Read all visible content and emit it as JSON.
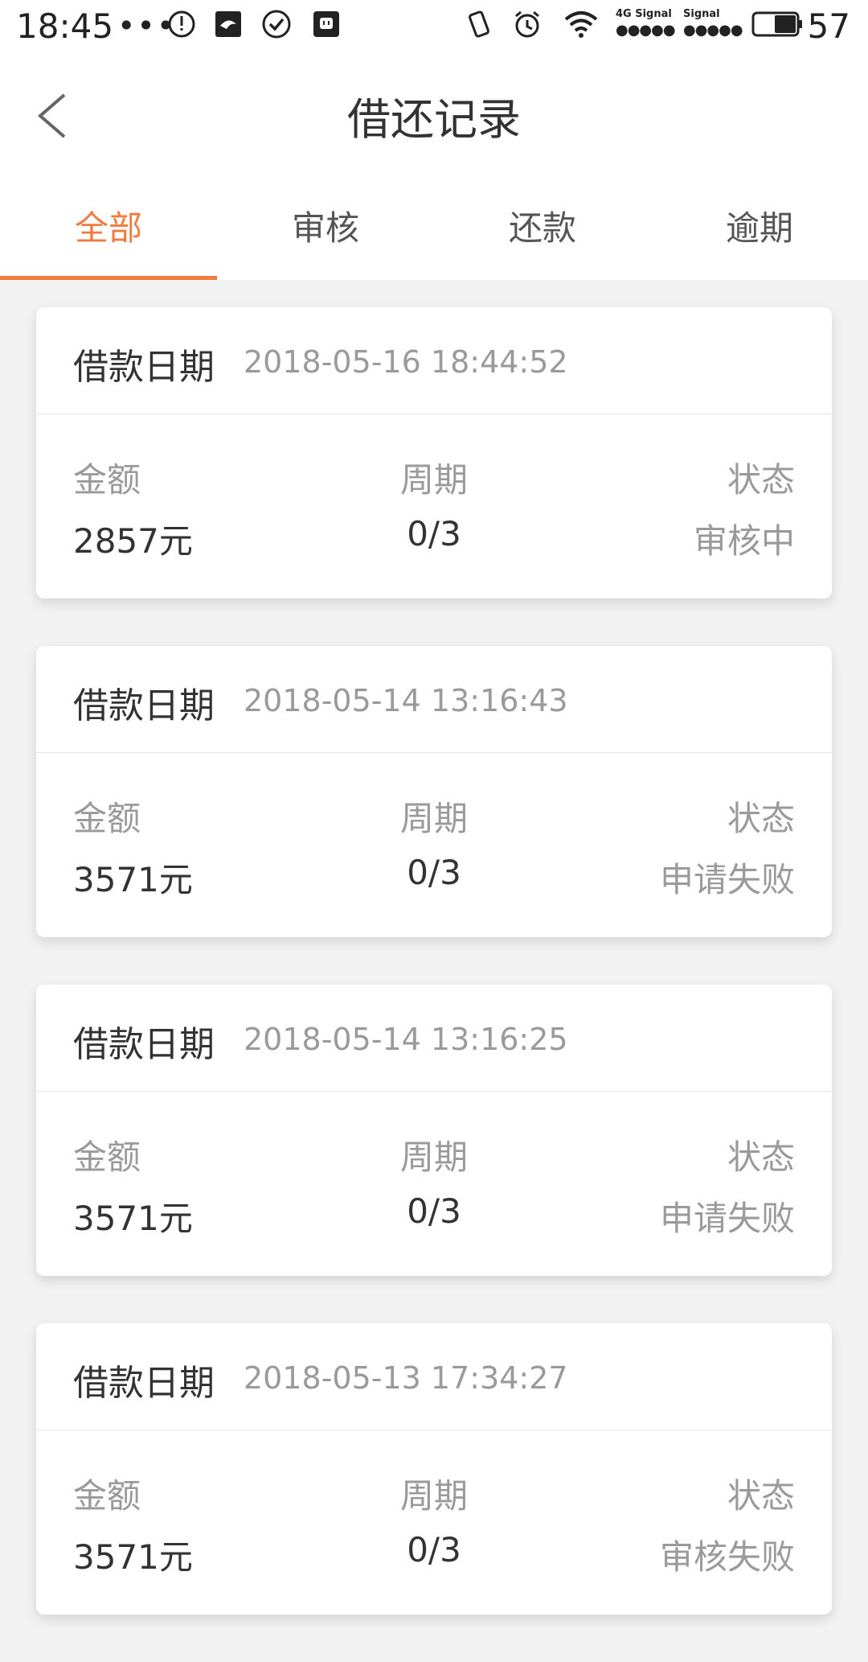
{
  "status_bar": {
    "time": "18:45",
    "dots": "•••",
    "signal_text_1": "4G Signal",
    "signal_text_2": "Signal",
    "battery": "57"
  },
  "header": {
    "title": "借还记录"
  },
  "tabs": [
    {
      "label": "全部",
      "active": true
    },
    {
      "label": "审核",
      "active": false
    },
    {
      "label": "还款",
      "active": false
    },
    {
      "label": "逾期",
      "active": false
    }
  ],
  "records": [
    {
      "date_label": "借款日期",
      "date": "2018-05-16 18:44:52",
      "amount_label": "金额",
      "amount": "2857元",
      "period_label": "周期",
      "period": "0/3",
      "status_label": "状态",
      "status": "审核中"
    },
    {
      "date_label": "借款日期",
      "date": "2018-05-14 13:16:43",
      "amount_label": "金额",
      "amount": "3571元",
      "period_label": "周期",
      "period": "0/3",
      "status_label": "状态",
      "status": "申请失败"
    },
    {
      "date_label": "借款日期",
      "date": "2018-05-14 13:16:25",
      "amount_label": "金额",
      "amount": "3571元",
      "period_label": "周期",
      "period": "0/3",
      "status_label": "状态",
      "status": "申请失败"
    },
    {
      "date_label": "借款日期",
      "date": "2018-05-13 17:34:27",
      "amount_label": "金额",
      "amount": "3571元",
      "period_label": "周期",
      "period": "0/3",
      "status_label": "状态",
      "status": "审核失败"
    }
  ],
  "colors": {
    "accent": "#f07b3f",
    "text_primary": "#333333",
    "text_secondary": "#9a9a9a",
    "background": "#f2f2f2"
  }
}
